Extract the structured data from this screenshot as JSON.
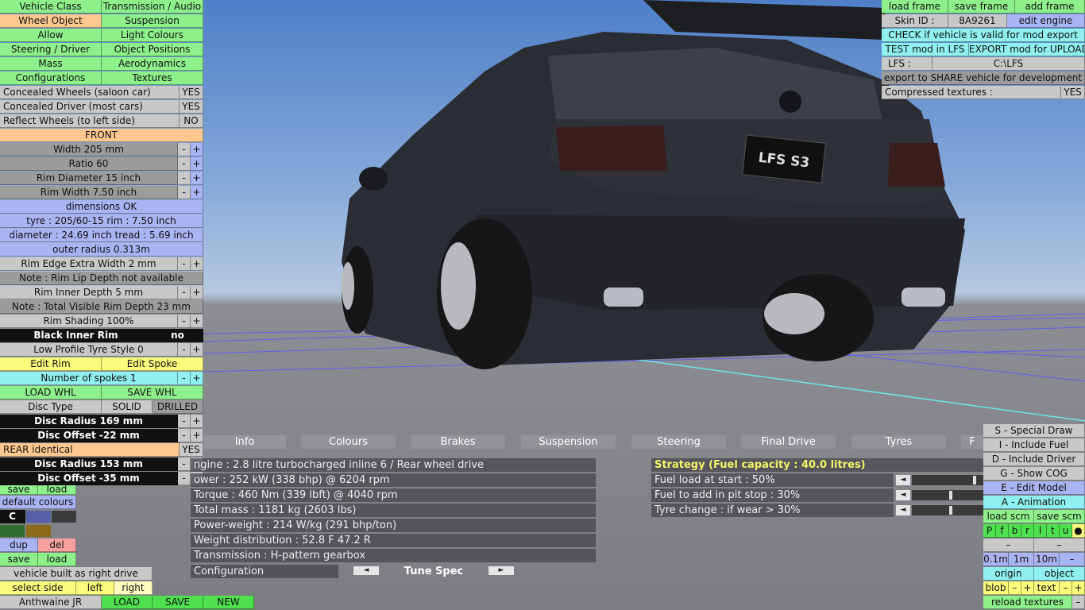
{
  "left_tabs": {
    "row1": [
      "Vehicle Class",
      "Transmission / Audio"
    ],
    "row2": [
      "Wheel Object",
      "Suspension"
    ],
    "row3": [
      "Allow",
      "Light Colours"
    ],
    "row4": [
      "Steering / Driver",
      "Object Positions"
    ],
    "row5": [
      "Mass",
      "Aerodynamics"
    ],
    "row6": [
      "Configurations",
      "Textures"
    ]
  },
  "wheel_options": {
    "concealed_wheels": {
      "label": "Concealed Wheels (saloon car)",
      "value": "YES"
    },
    "concealed_driver": {
      "label": "Concealed Driver (most cars)",
      "value": "YES"
    },
    "reflect_wheels": {
      "label": "Reflect Wheels (to left side)",
      "value": "NO"
    },
    "front_header": "FRONT",
    "width": "Width 205 mm",
    "ratio": "Ratio 60",
    "rim_diameter": "Rim Diameter 15 inch",
    "rim_width": "Rim Width 7.50 inch",
    "dimensions_ok": "dimensions OK",
    "tyre_info": "tyre : 205/60-15   rim : 7.50 inch",
    "diameter_info": "diameter : 24.69 inch   tread : 5.69 inch",
    "outer_radius": "outer radius 0.313m",
    "rim_edge": "Rim Edge Extra Width 2 mm",
    "note_rim_lip": "Note : Rim Lip Depth not available",
    "rim_inner_depth": "Rim Inner Depth 5 mm",
    "note_visible": "Note : Total Visible Rim Depth 23 mm",
    "rim_shading": "Rim Shading 100%",
    "black_inner_rim": {
      "label": "Black Inner Rim",
      "value": "no"
    },
    "low_profile": "Low Profile Tyre Style 0",
    "edit_rim": "Edit Rim",
    "edit_spoke": "Edit Spoke",
    "num_spokes": "Number of spokes 1",
    "load_whl": "LOAD WHL",
    "save_whl": "SAVE WHL",
    "disc_type": {
      "label": "Disc Type",
      "solid": "SOLID",
      "drilled": "DRILLED"
    },
    "disc_radius_front": "Disc Radius 169 mm",
    "disc_offset_front": "Disc Offset -22 mm",
    "rear_identical": {
      "label": "REAR identical",
      "value": "YES"
    },
    "disc_radius_rear": "Disc Radius 153 mm",
    "disc_offset_rear": "Disc Offset -35 mm",
    "minus": "-",
    "plus": "+"
  },
  "bottom_left": {
    "save": "save",
    "load": "load",
    "default_colours": "default colours",
    "c_label": "C",
    "dup": "dup",
    "del": "del",
    "save2": "save",
    "load2": "load",
    "right_drive": "vehicle built as right drive",
    "select_side": "select side",
    "left": "left",
    "right": "right",
    "vehicle_name": "Anthwaine JR",
    "load_btn": "LOAD",
    "save_btn": "SAVE",
    "new_btn": "NEW",
    "colors": {
      "swatch1": "#5560a8",
      "swatch2": "#3b3b3b",
      "swatch3": "#2f6a2f",
      "swatch4": "#8a6a1a"
    }
  },
  "top_right": {
    "load_frame": "load frame",
    "save_frame": "save frame",
    "add_frame": "add frame",
    "skin_id_label": "Skin ID :",
    "skin_id_value": "8A9261",
    "edit_engine": "edit engine",
    "check_valid": "CHECK if vehicle is valid for mod export",
    "test_mod": "TEST mod in LFS",
    "export_mod": "EXPORT mod for UPLOAD",
    "lfs_label": "LFS :",
    "lfs_path": "C:\\LFS",
    "export_share": "export to SHARE vehicle for development",
    "compressed_label": "Compressed textures :",
    "compressed_value": "YES"
  },
  "info_tabs": [
    "Info",
    "Colours",
    "Brakes",
    "Suspension",
    "Steering",
    "Final Drive",
    "Tyres",
    "F"
  ],
  "info_rows": [
    "ngine : 2.8 litre turbocharged inline 6 / Rear wheel drive",
    "ower : 252 kW (338 bhp) @ 6204 rpm",
    "Torque : 460 Nm (339 lbft) @ 4040 rpm",
    "Total mass : 1181 kg (2603 lbs)",
    "Power-weight : 214 W/kg (291 bhp/ton)",
    "Weight distribution : 52.8 F  47.2 R",
    "Transmission : H-pattern gearbox"
  ],
  "configuration": {
    "label": "Configuration",
    "value": "Tune Spec",
    "left_arrow": "◄",
    "right_arrow": "►"
  },
  "strategy": {
    "title": "Strategy (Fuel capacity : 40.0 litres)",
    "rows": [
      {
        "label": "Fuel load at start : 50%",
        "level": 0.9
      },
      {
        "label": "Fuel to add in pit stop : 30%",
        "level": 0.55
      },
      {
        "label": "Tyre change : if wear > 30%",
        "level": 0.55
      }
    ],
    "arrow": "◄"
  },
  "right_panel": {
    "special_draw": "S - Special Draw",
    "include_fuel": "I - Include Fuel",
    "include_driver": "D - Include Driver",
    "show_cog": "G - Show COG",
    "edit_model": "E - Edit Model",
    "animation": "A - Animation",
    "load_scm": "load scm",
    "save_scm": "save scm",
    "letters": [
      "P",
      "f",
      "b",
      "r",
      "l",
      "t",
      "u",
      "●"
    ],
    "dash": "–",
    "zoom1": "0.1m",
    "zoom2": "1m",
    "zoom3": "10m",
    "zoom_minus": "–",
    "origin": "origin",
    "object": "object",
    "blob": "blob",
    "text": "text",
    "minus": "–",
    "plus": "+",
    "reload_textures": "reload textures"
  },
  "plate": "LFS S3"
}
